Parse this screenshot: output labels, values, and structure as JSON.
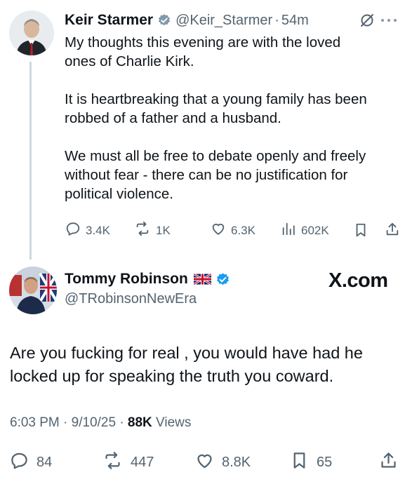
{
  "parent_tweet": {
    "author_name": "Keir Starmer",
    "handle": "@Keir_Starmer",
    "separator": "·",
    "time_ago": "54m",
    "body_paragraphs": [
      "My thoughts this evening are with the loved ones of Charlie Kirk.",
      "It is heartbreaking that a young family has been robbed of a father and a husband.",
      "We must all be free to debate openly and freely without fear - there can be no justification for political violence."
    ],
    "body_lines": [
      "My thoughts this evening are with the loved",
      "ones of Charlie Kirk.",
      "It is heartbreaking that a young family has been",
      "robbed of a father and a husband.",
      "We must all be free to debate openly and freely",
      "without fear - there can be no justification for",
      "political violence."
    ],
    "actions": {
      "replies": "3.4K",
      "reposts": "1K",
      "likes": "6.3K",
      "views": "602K"
    },
    "icons": [
      "verified-badge-icon",
      "grok-icon",
      "more-icon",
      "reply-icon",
      "repost-icon",
      "like-icon",
      "views-icon",
      "bookmark-icon",
      "share-icon"
    ]
  },
  "reply_tweet": {
    "author_name": "Tommy Robinson",
    "flag": "🇬🇧",
    "handle": "@TRobinsonNewEra",
    "watermark": "X.com",
    "body_lines": [
      "Are you fucking for real , you would have had he",
      "locked up for speaking the truth you coward."
    ],
    "timestamp": "6:03 PM · 9/10/25 · ",
    "views_count": "88K",
    "views_label": " Views",
    "actions": {
      "replies": "84",
      "reposts": "447",
      "likes": "8.8K",
      "bookmarks": "65"
    }
  },
  "colors": {
    "text": "#0f1419",
    "muted": "#536471",
    "verified_blue": "#1d9bf0",
    "thread_line": "#cfd9de"
  }
}
